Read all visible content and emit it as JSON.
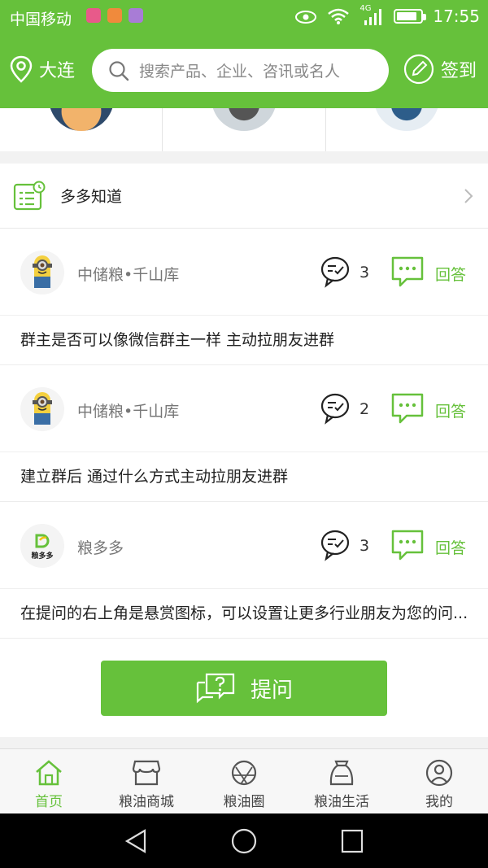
{
  "status_bar": {
    "carrier": "中国移动",
    "network": "4G",
    "time": "17:55"
  },
  "header": {
    "city": "大连",
    "search_placeholder": "搜索产品、企业、咨讯或名人",
    "signin_label": "签到"
  },
  "knowledge": {
    "title": "多多知道",
    "items": [
      {
        "user": "中储粮•千山库",
        "comment_count": "3",
        "answer_label": "回答",
        "question": "群主是否可以像微信群主一样 主动拉朋友进群"
      },
      {
        "user": "中储粮•千山库",
        "comment_count": "2",
        "answer_label": "回答",
        "question": "建立群后 通过什么方式主动拉朋友进群"
      },
      {
        "user": "粮多多",
        "avatar_text": "粮多多",
        "comment_count": "3",
        "answer_label": "回答",
        "question": "在提问的右上角是悬赏图标，可以设置让更多行业朋友为您的问..."
      }
    ],
    "ask_button": "提问"
  },
  "tabbar": {
    "tabs": [
      {
        "label": "首页",
        "icon": "home-icon",
        "active": true
      },
      {
        "label": "粮油商城",
        "icon": "shop-icon",
        "active": false
      },
      {
        "label": "粮油圈",
        "icon": "circle-icon",
        "active": false
      },
      {
        "label": "粮油生活",
        "icon": "bag-icon",
        "active": false
      },
      {
        "label": "我的",
        "icon": "user-icon",
        "active": false
      }
    ]
  },
  "colors": {
    "brand": "#66c13b",
    "text": "#222222",
    "muted": "#777777"
  }
}
